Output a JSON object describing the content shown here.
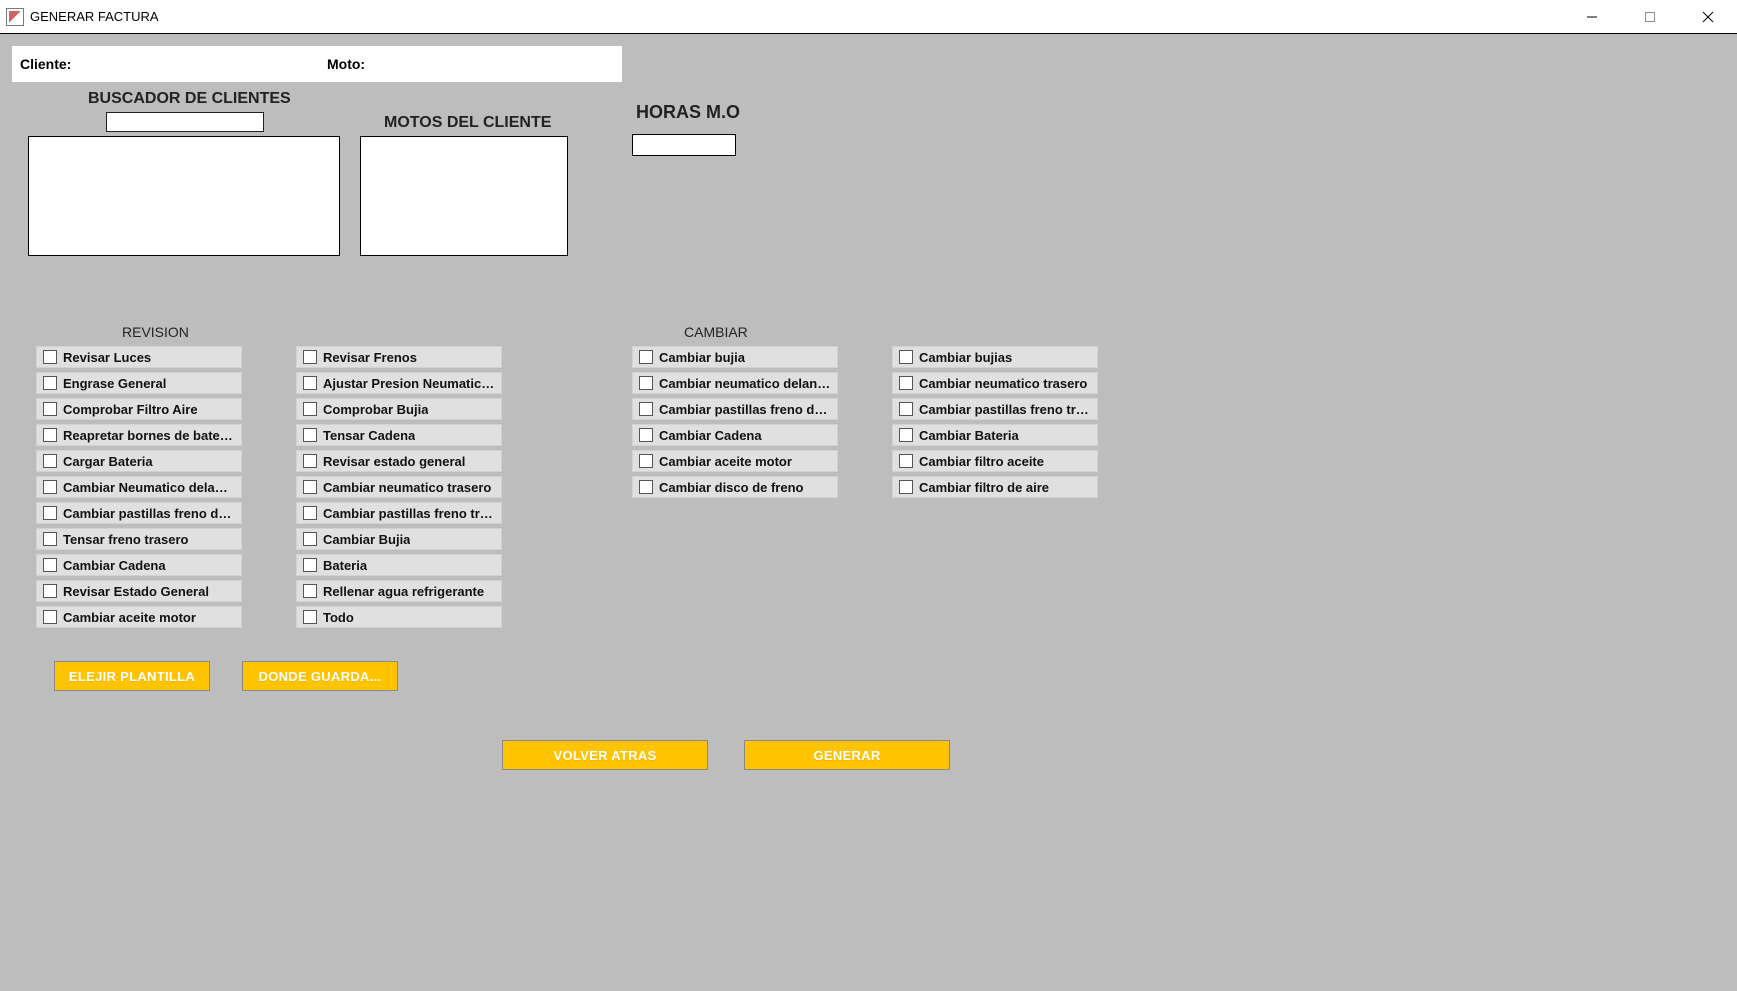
{
  "window": {
    "title": "GENERAR FACTURA"
  },
  "info_bar": {
    "cliente_label": "Cliente:",
    "moto_label": "Moto:"
  },
  "buscador": {
    "title": "BUSCADOR DE CLIENTES",
    "value": ""
  },
  "motos": {
    "title": "MOTOS DEL CLIENTE"
  },
  "horas": {
    "title": "HORAS M.O",
    "value": ""
  },
  "section_titles": {
    "revision": "REVISION",
    "cambiar": "CAMBIAR"
  },
  "revision_col1": [
    "Revisar Luces",
    "Engrase General",
    "Comprobar Filtro Aire",
    "Reapretar bornes de bateria y...",
    "Cargar Bateria",
    "Cambiar Neumatico delantero",
    "Cambiar pastillas freno delant...",
    "Tensar freno trasero",
    "Cambiar Cadena",
    "Revisar Estado General",
    "Cambiar aceite motor"
  ],
  "revision_col2": [
    "Revisar Frenos",
    "Ajustar Presion Neumaticos",
    "Comprobar Bujia",
    "Tensar Cadena",
    "Revisar estado general",
    "Cambiar neumatico trasero",
    "Cambiar pastillas freno trasero",
    "Cambiar Bujia",
    "Bateria",
    "Rellenar agua refrigerante",
    "Todo"
  ],
  "cambiar_col1": [
    "Cambiar bujia",
    "Cambiar neumatico delantero",
    "Cambiar pastillas freno delant...",
    "Cambiar Cadena",
    "Cambiar aceite motor",
    "Cambiar disco de freno"
  ],
  "cambiar_col2": [
    "Cambiar bujias",
    "Cambiar neumatico trasero",
    "Cambiar pastillas freno trasero",
    "Cambiar Bateria",
    "Cambiar filtro aceite",
    "Cambiar filtro de aire"
  ],
  "buttons": {
    "plantilla": "ELEJIR PLANTILLA",
    "guardar": "DONDE GUARDA...",
    "volver": "VOLVER ATRAS",
    "generar": "GENERAR"
  }
}
